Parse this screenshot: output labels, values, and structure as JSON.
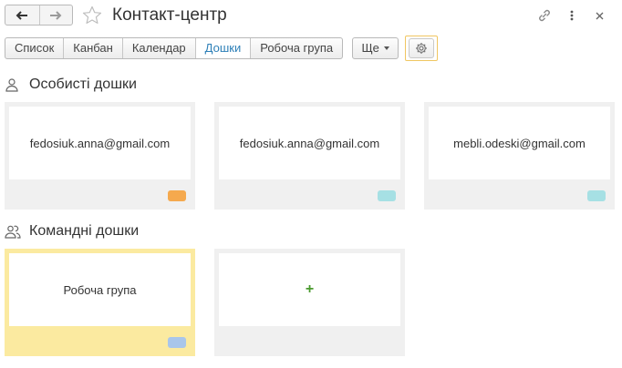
{
  "window": {
    "title": "Контакт-центр"
  },
  "toolbar": {
    "tabs": [
      {
        "label": "Список",
        "active": false
      },
      {
        "label": "Канбан",
        "active": false
      },
      {
        "label": "Календар",
        "active": false
      },
      {
        "label": "Дошки",
        "active": true
      },
      {
        "label": "Робоча група",
        "active": false
      }
    ],
    "more_label": "Ще"
  },
  "sections": {
    "personal": {
      "title": "Особисті дошки",
      "boards": [
        {
          "label": "fedosiuk.anna@gmail.com",
          "tag_color": "#f5a94e"
        },
        {
          "label": "fedosiuk.anna@gmail.com",
          "tag_color": "#a6e0e4"
        },
        {
          "label": "mebli.odeski@gmail.com",
          "tag_color": "#a6e0e4"
        }
      ]
    },
    "team": {
      "title": "Командні дошки",
      "boards": [
        {
          "label": "Робоча група",
          "tag_color": "#a9c6ea"
        },
        {
          "label": "+"
        }
      ]
    }
  },
  "colors": {
    "active_tab": "#2e80b8",
    "highlight_border": "#f0c661",
    "team_board_bg": "#fbeaa0",
    "add_plus": "#4a9a2e"
  },
  "icons": {
    "back": "arrow-left-icon",
    "forward": "arrow-right-icon",
    "favorite": "star-icon",
    "link": "link-icon",
    "menu": "kebab-menu-icon",
    "close": "close-icon",
    "settings": "gear-icon",
    "personal": "person-icon",
    "team": "people-icon"
  }
}
